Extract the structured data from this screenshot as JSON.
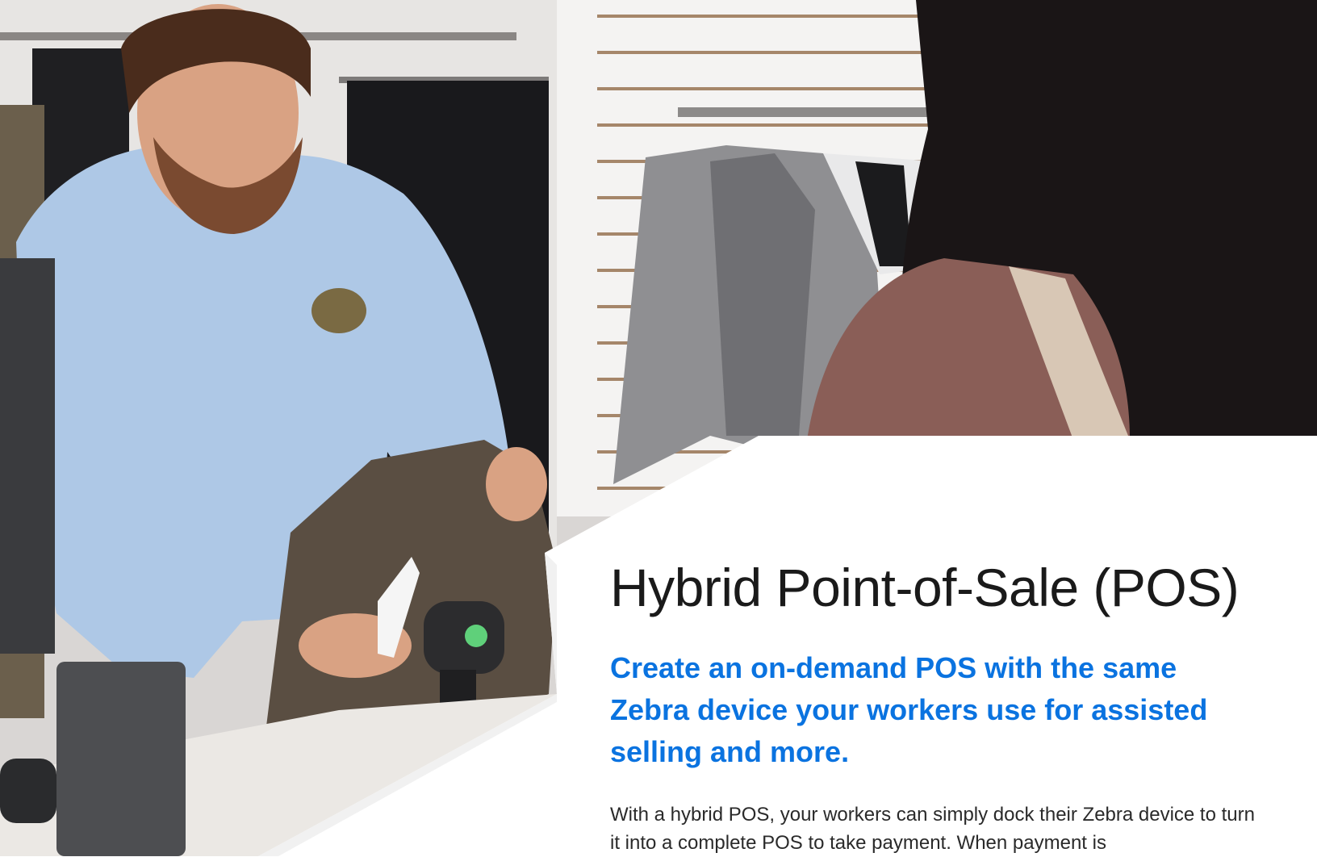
{
  "document": {
    "title": "Hybrid Point-of-Sale (POS)",
    "subheadline": "Create an on-demand POS with the same Zebra device your workers use for assisted selling and more.",
    "body": "With a hybrid POS, your workers can simply dock their Zebra device to turn it into a complete POS to take payment. When payment is"
  },
  "colors": {
    "title": "#1a1a1a",
    "accent": "#0a73e0",
    "body": "#2a2a2a",
    "panel": "#ffffff"
  },
  "photo": {
    "subject": "retail-checkout-scene",
    "badge_text": ""
  }
}
